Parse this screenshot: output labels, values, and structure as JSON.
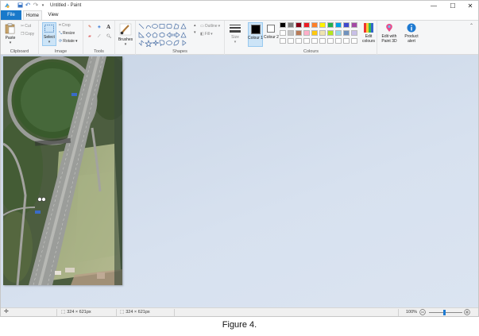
{
  "window": {
    "title": "Untitled - Paint",
    "controls": [
      "—",
      "☐",
      "✕"
    ]
  },
  "tabs": [
    {
      "label": "File"
    },
    {
      "label": "Home"
    },
    {
      "label": "View"
    }
  ],
  "ribbon": {
    "clipboard": {
      "paste": "Paste",
      "cut": "Cut",
      "copy": "Copy",
      "group": "Clipboard"
    },
    "image": {
      "select": "Select",
      "crop": "Crop",
      "resize": "Resize",
      "rotate": "Rotate",
      "group": "Image"
    },
    "tools": {
      "group": "Tools"
    },
    "brushes": {
      "label": "Brushes"
    },
    "shapes": {
      "outline": "Outline",
      "fill": "Fill",
      "group": "Shapes"
    },
    "size": {
      "label": "Size"
    },
    "colours": {
      "colour1": "Colour 1",
      "colour2": "Colour 2",
      "edit": "Edit colours",
      "group": "Colours",
      "row1": [
        "#000000",
        "#7f7f7f",
        "#880015",
        "#ed1c24",
        "#ff7f27",
        "#fff200",
        "#22b14c",
        "#00a2e8",
        "#3f48cc",
        "#a349a4"
      ],
      "row2": [
        "#ffffff",
        "#c3c3c3",
        "#b97a57",
        "#ffaec9",
        "#ffc90e",
        "#efe4b0",
        "#b5e61d",
        "#99d9ea",
        "#7092be",
        "#c8bfe7"
      ]
    },
    "paint3d": "Edit with Paint 3D",
    "product_alert": "Product alert"
  },
  "status": {
    "selection_size": "324 × 621px",
    "image_size": "324 × 621px",
    "zoom": "100%"
  },
  "caption": "Figure 4."
}
